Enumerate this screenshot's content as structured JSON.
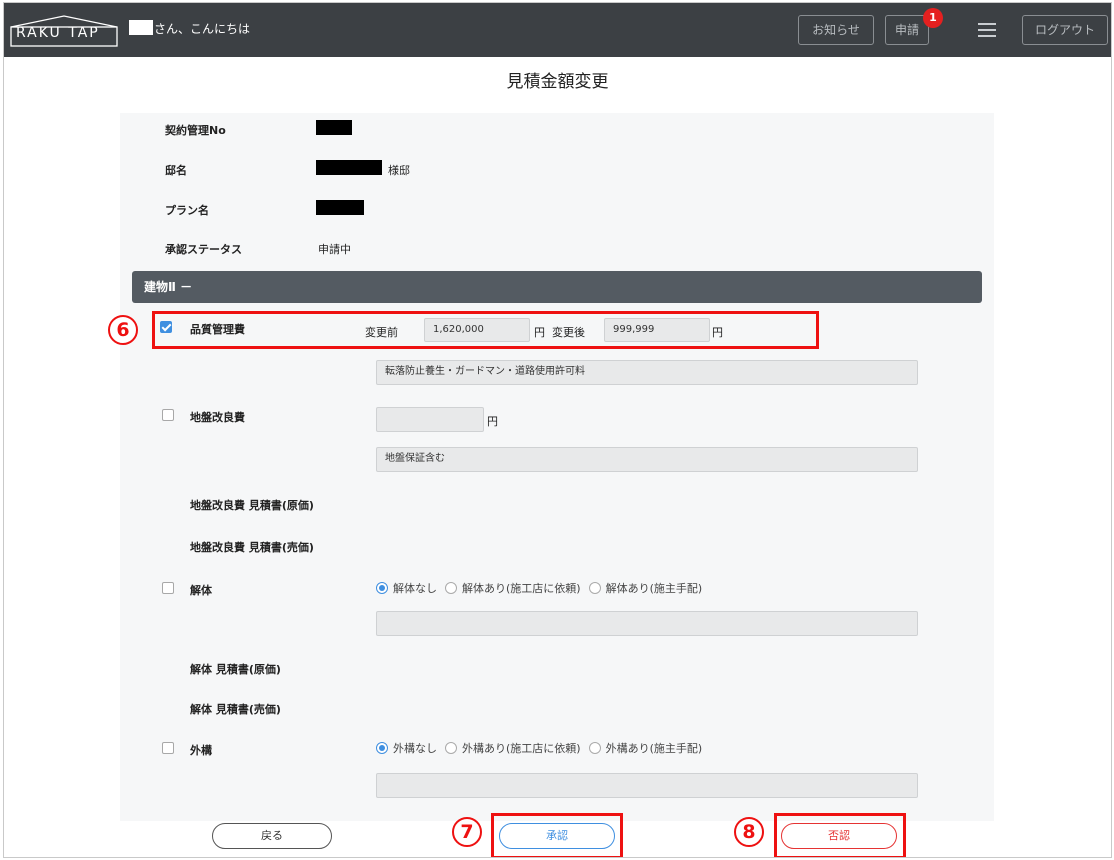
{
  "header": {
    "logo_text": "RAKU TAP",
    "greeting": "さん、こんにちは",
    "notice_label": "お知らせ",
    "request_label": "申請",
    "request_badge": "1",
    "logout_label": "ログアウト"
  },
  "page_title": "見積金額変更",
  "info": {
    "contract_no_label": "契約管理No",
    "house_label": "邸名",
    "house_suffix": "様邸",
    "plan_label": "プラン名",
    "status_label": "承認ステータス",
    "status_value": "申請中"
  },
  "section": {
    "title": "建物Ⅱ －"
  },
  "items": {
    "quality": {
      "label": "品質管理費",
      "before_label": "変更前",
      "before_value": "1,620,000",
      "unit": "円",
      "after_label": "変更後",
      "after_value": "999,999",
      "note": "転落防止養生・ガードマン・道路使用許可料",
      "checked": true
    },
    "ground": {
      "label": "地盤改良費",
      "unit": "円",
      "note": "地盤保証含む",
      "estimate_cost_label": "地盤改良費 見積書(原価)",
      "estimate_sale_label": "地盤改良費 見積書(売価)"
    },
    "demolition": {
      "label": "解体",
      "options": [
        "解体なし",
        "解体あり(施工店に依頼)",
        "解体あり(施主手配)"
      ],
      "selected": "解体なし",
      "estimate_cost_label": "解体 見積書(原価)",
      "estimate_sale_label": "解体 見積書(売価)"
    },
    "exterior": {
      "label": "外構",
      "options": [
        "外構なし",
        "外構あり(施工店に依頼)",
        "外構あり(施主手配)"
      ],
      "selected": "外構なし"
    }
  },
  "buttons": {
    "back": "戻る",
    "approve": "承認",
    "reject": "否認"
  },
  "callouts": {
    "c6": "6",
    "c7": "7",
    "c8": "8"
  },
  "colors": {
    "topbar": "#3c4044",
    "accent_blue": "#3f8fe0",
    "callout_red": "#ee1111",
    "section_bar": "#545b62"
  }
}
